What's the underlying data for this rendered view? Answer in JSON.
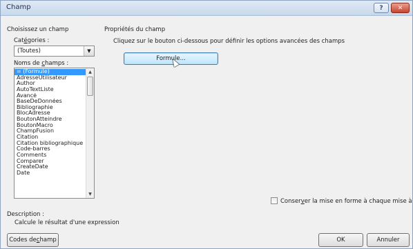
{
  "window": {
    "title": "Champ",
    "help_glyph": "?",
    "close_glyph": "✕"
  },
  "left_panel": {
    "heading": "Choisissez un champ",
    "categories_label_pre": "Cat",
    "categories_label_mnemonic": "é",
    "categories_label_post": "gories :",
    "categories_value": "(Toutes)",
    "field_names_label_pre": "Noms de ",
    "field_names_label_mnemonic": "c",
    "field_names_label_post": "hamps :",
    "field_names": [
      "= (Formule)",
      "AdresseUtilisateur",
      "Author",
      "AutoTextListe",
      "Avancé",
      "BaseDeDonnées",
      "Bibliographie",
      "BlocAdresse",
      "BoutonAtteindre",
      "BoutonMacro",
      "ChampFusion",
      "Citation",
      "Citation bibliographique",
      "Code-barres",
      "Comments",
      "Comparer",
      "CreateDate",
      "Date"
    ],
    "selected_index": 0
  },
  "right_panel": {
    "heading": "Propriétés du champ",
    "instruction": "Cliquez sur le bouton ci-dessous pour définir les options avancées des champs",
    "formula_button": "Formule..."
  },
  "preserve_format": {
    "label_pre": "Conser",
    "label_mnemonic": "v",
    "label_post": "er la mise en forme à chaque mise à jour",
    "checked": false
  },
  "description": {
    "label": "Description :",
    "text": "Calcule le résultat d'une expression"
  },
  "footer": {
    "field_codes_pre": "Codes de ",
    "field_codes_mnemonic": "c",
    "field_codes_post": "hamp",
    "ok": "OK",
    "cancel": "Annuler"
  },
  "icons": {
    "combo_arrow": "▼",
    "scroll_up": "▲",
    "scroll_down": "▼"
  },
  "colors": {
    "selection": "#3399ff",
    "formula_button_bg": "#bee6fd",
    "close_button": "#c9442e"
  }
}
